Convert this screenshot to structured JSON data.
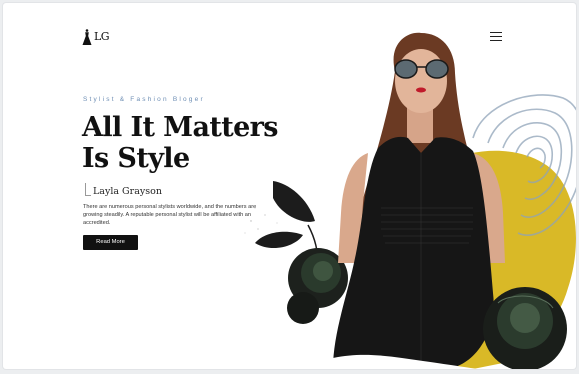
{
  "header": {
    "logo_text": "LG",
    "logo_icon": "dress-icon",
    "menu_icon": "hamburger-menu-icon"
  },
  "hero": {
    "tagline": "Stylist & Fashion Bloger",
    "headline_line1": "All It Matters",
    "headline_line2": "Is Style",
    "author": "Layla Grayson",
    "description": "There are numerous personal stylists worldwide, and the numbers are growing steadily. A reputable personal stylist will be affiliated with an accredited.",
    "button_label": "Read More"
  },
  "colors": {
    "accent_yellow": "#d9b927",
    "text_dark": "#111111",
    "tagline_blue": "#6f8fb5",
    "button_bg": "#111111"
  }
}
